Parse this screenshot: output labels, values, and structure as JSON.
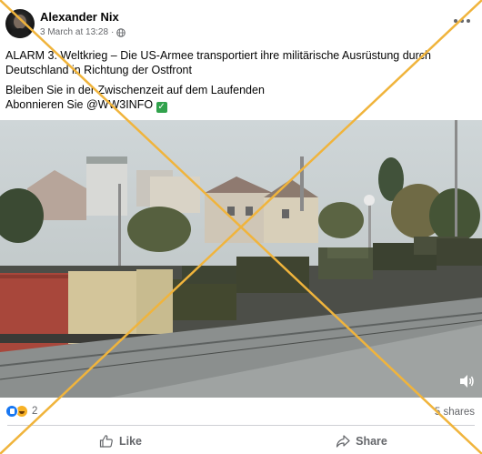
{
  "post": {
    "author": "Alexander Nix",
    "timestamp": "3 March at 13:28",
    "text_line1": "ALARM 3. Weltkrieg – Die US-Armee transportiert ihre militärische Ausrüstung durch Deutschland in Richtung der Ostfront",
    "text_line2": "Bleiben Sie in der Zwischenzeit auf dem Laufenden",
    "text_line3": "Abonnieren Sie @WW3INFO",
    "check_glyph": "✓"
  },
  "stats": {
    "reaction_count": "2",
    "shares": "5 shares"
  },
  "actions": {
    "like_label": "Like",
    "share_label": "Share"
  },
  "icons": {
    "globe": "globe-icon",
    "more": "more-options-icon",
    "like": "thumbs-up-icon",
    "share": "share-arrow-icon",
    "volume": "volume-icon",
    "checkmark": "check-mark-button-emoji"
  },
  "colors": {
    "fact_check_cross": "#f0b43c",
    "like_blue": "#1877f2",
    "secondary_text": "#65676b",
    "checkmark_green": "#31a24c"
  }
}
